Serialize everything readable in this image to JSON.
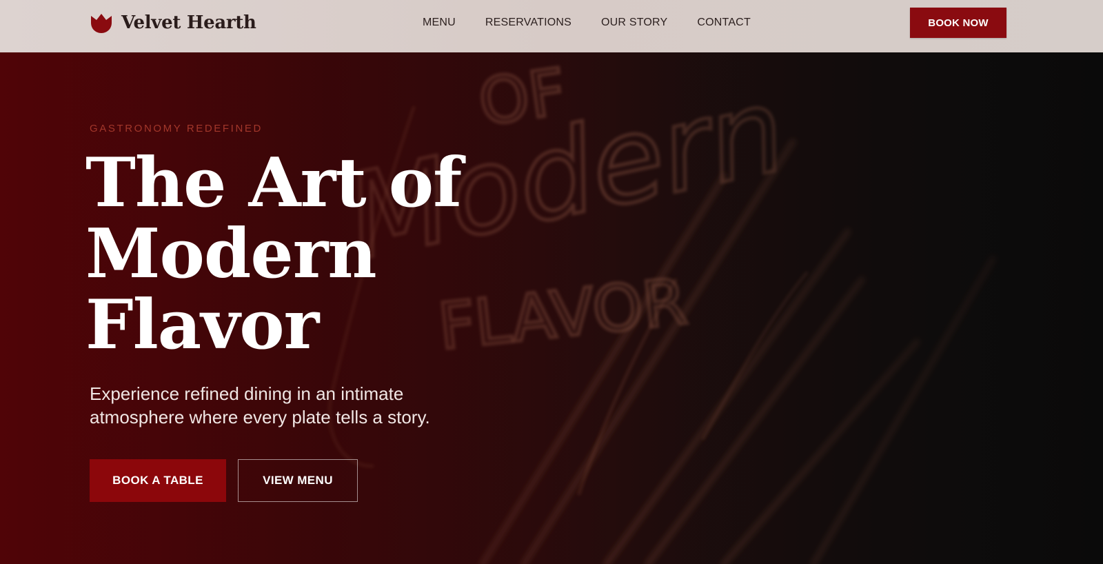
{
  "header": {
    "brand_name": "Velvet Hearth",
    "brand_icon": "tulip-icon",
    "nav": [
      {
        "label": "MENU"
      },
      {
        "label": "RESERVATIONS"
      },
      {
        "label": "OUR STORY"
      },
      {
        "label": "CONTACT"
      }
    ],
    "cta_label": "BOOK NOW"
  },
  "hero": {
    "eyebrow": "GASTRONOMY REDEFINED",
    "headline_lines": [
      "The Art of",
      "Modern",
      "Flavor"
    ],
    "subtext": "Experience refined dining in an intimate atmosphere where every plate tells a story.",
    "primary_button": "BOOK A TABLE",
    "secondary_button": "VIEW MENU",
    "background_image_text": [
      "OF",
      "Modern",
      "FLAVOR"
    ]
  },
  "colors": {
    "brand_red": "#8a0b10",
    "eyebrow_accent": "#a3372b",
    "header_bg": "#d9cfcb",
    "hero_dark": "#0c0b0b"
  }
}
